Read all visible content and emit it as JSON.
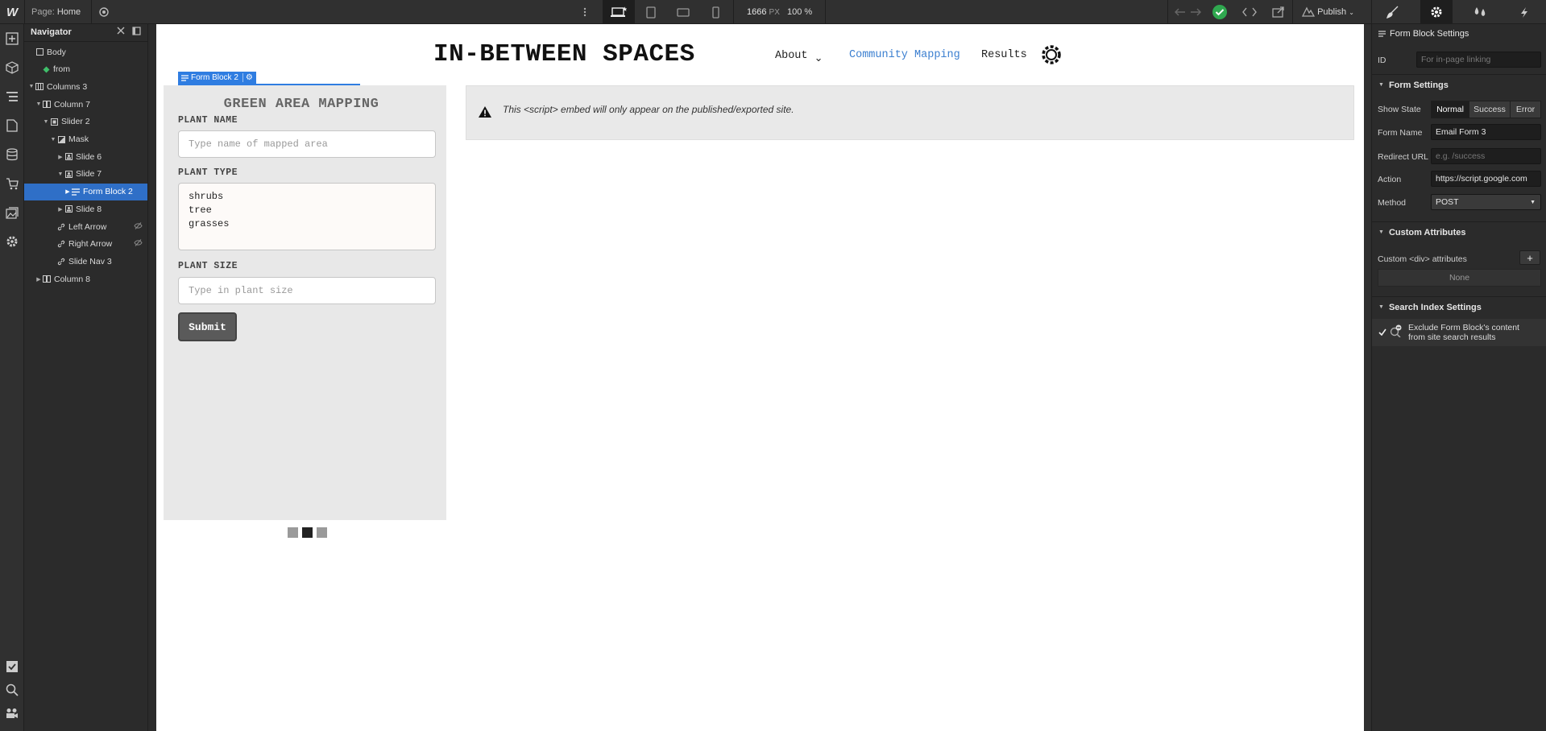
{
  "topbar": {
    "page_label": "Page:",
    "page_name": "Home",
    "canvas_width": "1666",
    "canvas_unit": "PX",
    "zoom": "100 %",
    "publish_label": "Publish"
  },
  "navigator": {
    "title": "Navigator",
    "items": [
      {
        "label": "Body",
        "icon": "box-icon"
      },
      {
        "label": "from",
        "icon": "component-icon"
      },
      {
        "label": "Columns 3",
        "icon": "columns-icon"
      },
      {
        "label": "Column 7",
        "icon": "column-icon"
      },
      {
        "label": "Slider 2",
        "icon": "slider-icon"
      },
      {
        "label": "Mask",
        "icon": "mask-icon"
      },
      {
        "label": "Slide 6",
        "icon": "slide-icon"
      },
      {
        "label": "Slide 7",
        "icon": "slide-icon"
      },
      {
        "label": "Form Block 2",
        "icon": "form-icon"
      },
      {
        "label": "Slide 8",
        "icon": "slide-icon"
      },
      {
        "label": "Left Arrow",
        "icon": "link-icon"
      },
      {
        "label": "Right Arrow",
        "icon": "link-icon"
      },
      {
        "label": "Slide Nav 3",
        "icon": "link-icon"
      },
      {
        "label": "Column 8",
        "icon": "column-icon"
      }
    ]
  },
  "site": {
    "title": "IN-BETWEEN SPACES",
    "nav": {
      "about": "About",
      "mapping": "Community Mapping",
      "results": "Results"
    },
    "selection_tag": "Form Block 2",
    "form": {
      "title": "GREEN AREA MAPPING",
      "plant_name_label": "PLANT NAME",
      "plant_name_placeholder": "Type name of mapped area",
      "plant_type_label": "PLANT TYPE",
      "plant_type_lines": [
        "shrubs",
        "tree",
        "grasses"
      ],
      "plant_size_label": "PLANT SIZE",
      "plant_size_placeholder": "Type in plant size",
      "submit": "Submit"
    },
    "embed_notice": "This <script> embed will only appear on the published/exported site."
  },
  "panel": {
    "header": "Form Block Settings",
    "id_label": "ID",
    "id_placeholder": "For in-page linking",
    "form_settings_title": "Form Settings",
    "show_state_label": "Show State",
    "states": [
      "Normal",
      "Success",
      "Error"
    ],
    "form_name_label": "Form Name",
    "form_name_value": "Email Form 3",
    "redirect_label": "Redirect URL",
    "redirect_placeholder": "e.g. /success",
    "action_label": "Action",
    "action_value": "https://script.google.com",
    "method_label": "Method",
    "method_value": "POST",
    "custom_attr_title": "Custom Attributes",
    "custom_div_label": "Custom <div> attributes",
    "none_label": "None",
    "search_index_title": "Search Index Settings",
    "exclude_line1": "Exclude Form Block's content",
    "exclude_line2": "from site search results"
  },
  "colors": {
    "accent": "#2f7de1",
    "selected_row": "#2f6fc7",
    "publish_ok": "#2fa84f",
    "link": "#3b7fd0"
  }
}
